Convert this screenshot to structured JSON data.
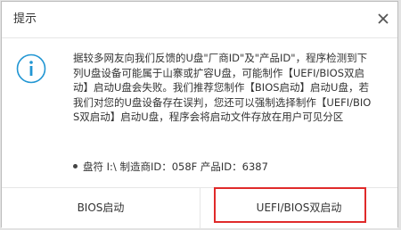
{
  "dialog": {
    "title": "提示",
    "message": "据较多网友向我们反馈的U盘\"厂商ID\"及\"产品ID\"，程序检测到下列U盘设备可能属于山寨或扩容U盘，可能制作【UEFI/BIOS双启动】启动U盘会失败。我们推荐您制作【BIOS启动】启动U盘，若我们对您的U盘设备存在误判，您还可以强制选择制作【UEFI/BIOS双启动】启动U盘，程序会将启动文件存放在用户可见分区",
    "device_line": "盘符 I:\\ 制造商ID：058F 产品ID：6387"
  },
  "buttons": {
    "bios": "BIOS启动",
    "uefi_bios": "UEFI/BIOS双启动"
  },
  "icons": {
    "info": "info-circle-icon",
    "close": "close-icon",
    "bullet": "bullet-dot-icon"
  },
  "colors": {
    "info_icon": "#2196d3",
    "highlight_border": "#e02a2a",
    "text": "#333333"
  }
}
